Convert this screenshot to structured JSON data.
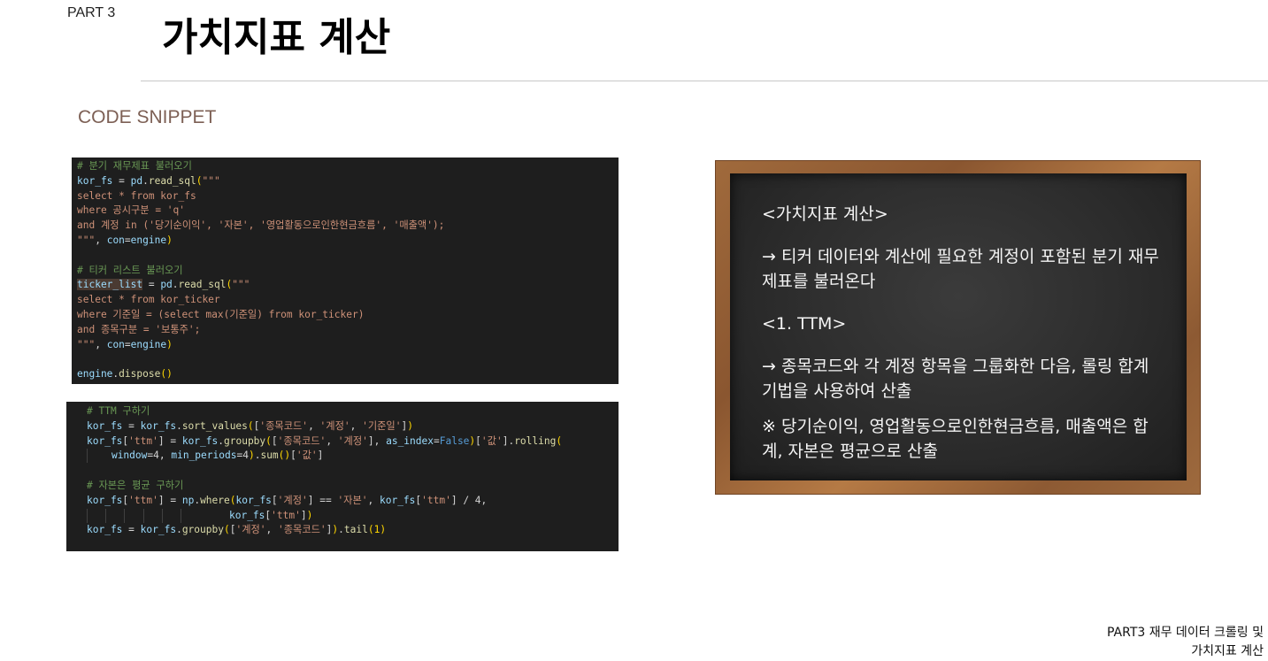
{
  "header": {
    "part_label": "PART 3",
    "title": "가치지표 계산",
    "section_label": "CODE SNIPPET"
  },
  "code_snippet_1": {
    "lines": [
      [
        [
          "# 분기 재무제표 불러오기",
          "comment"
        ]
      ],
      [
        [
          "kor_fs",
          "var"
        ],
        [
          " = ",
          "op"
        ],
        [
          "pd",
          "var"
        ],
        [
          ".",
          "op"
        ],
        [
          "read_sql",
          "func"
        ],
        [
          "(",
          "brk"
        ],
        [
          "\"\"\"",
          "str"
        ]
      ],
      [
        [
          "select * from kor_fs",
          "str"
        ]
      ],
      [
        [
          "where 공시구분 = 'q'",
          "str"
        ]
      ],
      [
        [
          "and 계정 in ('당기순이익', '자본', '영업활동으로인한현금흐름', '매출액');",
          "str"
        ]
      ],
      [
        [
          "\"\"\"",
          "str"
        ],
        [
          ", ",
          "op"
        ],
        [
          "con",
          "var"
        ],
        [
          "=",
          "op"
        ],
        [
          "engine",
          "var"
        ],
        [
          ")",
          "brk"
        ]
      ],
      [],
      [
        [
          "# 티커 리스트 불러오기",
          "comment"
        ]
      ],
      [
        [
          "ticker_list",
          "hl"
        ],
        [
          " = ",
          "op"
        ],
        [
          "pd",
          "var"
        ],
        [
          ".",
          "op"
        ],
        [
          "read_sql",
          "func"
        ],
        [
          "(",
          "brk"
        ],
        [
          "\"\"\"",
          "str"
        ]
      ],
      [
        [
          "select * from kor_ticker",
          "str"
        ]
      ],
      [
        [
          "where 기준일 = (select max(기준일) from kor_ticker)",
          "str"
        ]
      ],
      [
        [
          "and 종목구분 = '보통주';",
          "str"
        ]
      ],
      [
        [
          "\"\"\"",
          "str"
        ],
        [
          ", ",
          "op"
        ],
        [
          "con",
          "var"
        ],
        [
          "=",
          "op"
        ],
        [
          "engine",
          "var"
        ],
        [
          ")",
          "brk"
        ]
      ],
      [],
      [
        [
          "engine",
          "var"
        ],
        [
          ".",
          "op"
        ],
        [
          "dispose",
          "func"
        ],
        [
          "()",
          "brk"
        ]
      ]
    ]
  },
  "code_snippet_2": {
    "lines": [
      [
        [
          "# TTM 구하기",
          "comment"
        ]
      ],
      [
        [
          "kor_fs",
          "var"
        ],
        [
          " = ",
          "op"
        ],
        [
          "kor_fs",
          "var"
        ],
        [
          ".",
          "op"
        ],
        [
          "sort_values",
          "func"
        ],
        [
          "(",
          "brk"
        ],
        [
          "[",
          "op"
        ],
        [
          "'종목코드'",
          "str"
        ],
        [
          ", ",
          "op"
        ],
        [
          "'계정'",
          "str"
        ],
        [
          ", ",
          "op"
        ],
        [
          "'기준일'",
          "str"
        ],
        [
          "]",
          "op"
        ],
        [
          ")",
          "brk"
        ]
      ],
      [
        [
          "kor_fs",
          "var"
        ],
        [
          "[",
          "op"
        ],
        [
          "'ttm'",
          "str"
        ],
        [
          "]",
          "op"
        ],
        [
          " = ",
          "op"
        ],
        [
          "kor_fs",
          "var"
        ],
        [
          ".",
          "op"
        ],
        [
          "groupby",
          "func"
        ],
        [
          "(",
          "brk"
        ],
        [
          "[",
          "op"
        ],
        [
          "'종목코드'",
          "str"
        ],
        [
          ", ",
          "op"
        ],
        [
          "'계정'",
          "str"
        ],
        [
          "]",
          "op"
        ],
        [
          ", ",
          "op"
        ],
        [
          "as_index",
          "var"
        ],
        [
          "=",
          "op"
        ],
        [
          "False",
          "const"
        ],
        [
          ")",
          "brk"
        ],
        [
          "[",
          "op"
        ],
        [
          "'값'",
          "str"
        ],
        [
          "]",
          "op"
        ],
        [
          ".",
          "op"
        ],
        [
          "rolling",
          "func"
        ],
        [
          "(",
          "brk"
        ]
      ],
      [
        [
          "guide",
          "guide"
        ],
        [
          "    ",
          "op"
        ],
        [
          "window",
          "var"
        ],
        [
          "=",
          "op"
        ],
        [
          "4",
          "op"
        ],
        [
          ", ",
          "op"
        ],
        [
          "min_periods",
          "var"
        ],
        [
          "=",
          "op"
        ],
        [
          "4",
          "op"
        ],
        [
          ")",
          "brk"
        ],
        [
          ".",
          "op"
        ],
        [
          "sum",
          "func"
        ],
        [
          "()",
          "brk"
        ],
        [
          "[",
          "op"
        ],
        [
          "'값'",
          "str"
        ],
        [
          "]",
          "op"
        ]
      ],
      [],
      [
        [
          "# 자본은 평균 구하기",
          "comment"
        ]
      ],
      [
        [
          "kor_fs",
          "var"
        ],
        [
          "[",
          "op"
        ],
        [
          "'ttm'",
          "str"
        ],
        [
          "]",
          "op"
        ],
        [
          " = ",
          "op"
        ],
        [
          "np",
          "var"
        ],
        [
          ".",
          "op"
        ],
        [
          "where",
          "func"
        ],
        [
          "(",
          "brk"
        ],
        [
          "kor_fs",
          "var"
        ],
        [
          "[",
          "op"
        ],
        [
          "'계정'",
          "str"
        ],
        [
          "]",
          "op"
        ],
        [
          " == ",
          "op"
        ],
        [
          "'자본'",
          "str"
        ],
        [
          ", ",
          "op"
        ],
        [
          "kor_fs",
          "var"
        ],
        [
          "[",
          "op"
        ],
        [
          "'ttm'",
          "str"
        ],
        [
          "]",
          "op"
        ],
        [
          " / 4,",
          "op"
        ]
      ],
      [
        [
          "guide",
          "guide"
        ],
        [
          "   ",
          "op"
        ],
        [
          "guide",
          "guide"
        ],
        [
          "   ",
          "op"
        ],
        [
          "guide",
          "guide"
        ],
        [
          "   ",
          "op"
        ],
        [
          "guide",
          "guide"
        ],
        [
          "   ",
          "op"
        ],
        [
          "guide",
          "guide"
        ],
        [
          "   ",
          "op"
        ],
        [
          "guide",
          "guide"
        ],
        [
          "        ",
          "op"
        ],
        [
          "kor_fs",
          "var"
        ],
        [
          "[",
          "op"
        ],
        [
          "'ttm'",
          "str"
        ],
        [
          "]",
          "op"
        ],
        [
          ")",
          "brk"
        ]
      ],
      [
        [
          "kor_fs",
          "var"
        ],
        [
          " = ",
          "op"
        ],
        [
          "kor_fs",
          "var"
        ],
        [
          ".",
          "op"
        ],
        [
          "groupby",
          "func"
        ],
        [
          "(",
          "brk"
        ],
        [
          "[",
          "op"
        ],
        [
          "'계정'",
          "str"
        ],
        [
          ", ",
          "op"
        ],
        [
          "'종목코드'",
          "str"
        ],
        [
          "]",
          "op"
        ],
        [
          ")",
          "brk"
        ],
        [
          ".",
          "op"
        ],
        [
          "tail",
          "func"
        ],
        [
          "(1)",
          "brk"
        ]
      ]
    ]
  },
  "chalkboard": {
    "heading": "<가치지표 계산>",
    "point_1": "→ 티커 데이터와 계산에 필요한 계정이 포함된 분기 재무제표를 불러온다",
    "subheading": "<1. TTM>",
    "point_2": "→ 종목코드와 각 계정 항목을 그룹화한 다음, 롤링 합계 기법을 사용하여 산출",
    "note": "※ 당기순이익, 영업활동으로인한현금흐름, 매출액은 합계, 자본은 평균으로 산출"
  },
  "footer": {
    "line_1": "PART3 재무 데이터 크롤링 및",
    "line_2": "가치지표 계산"
  }
}
